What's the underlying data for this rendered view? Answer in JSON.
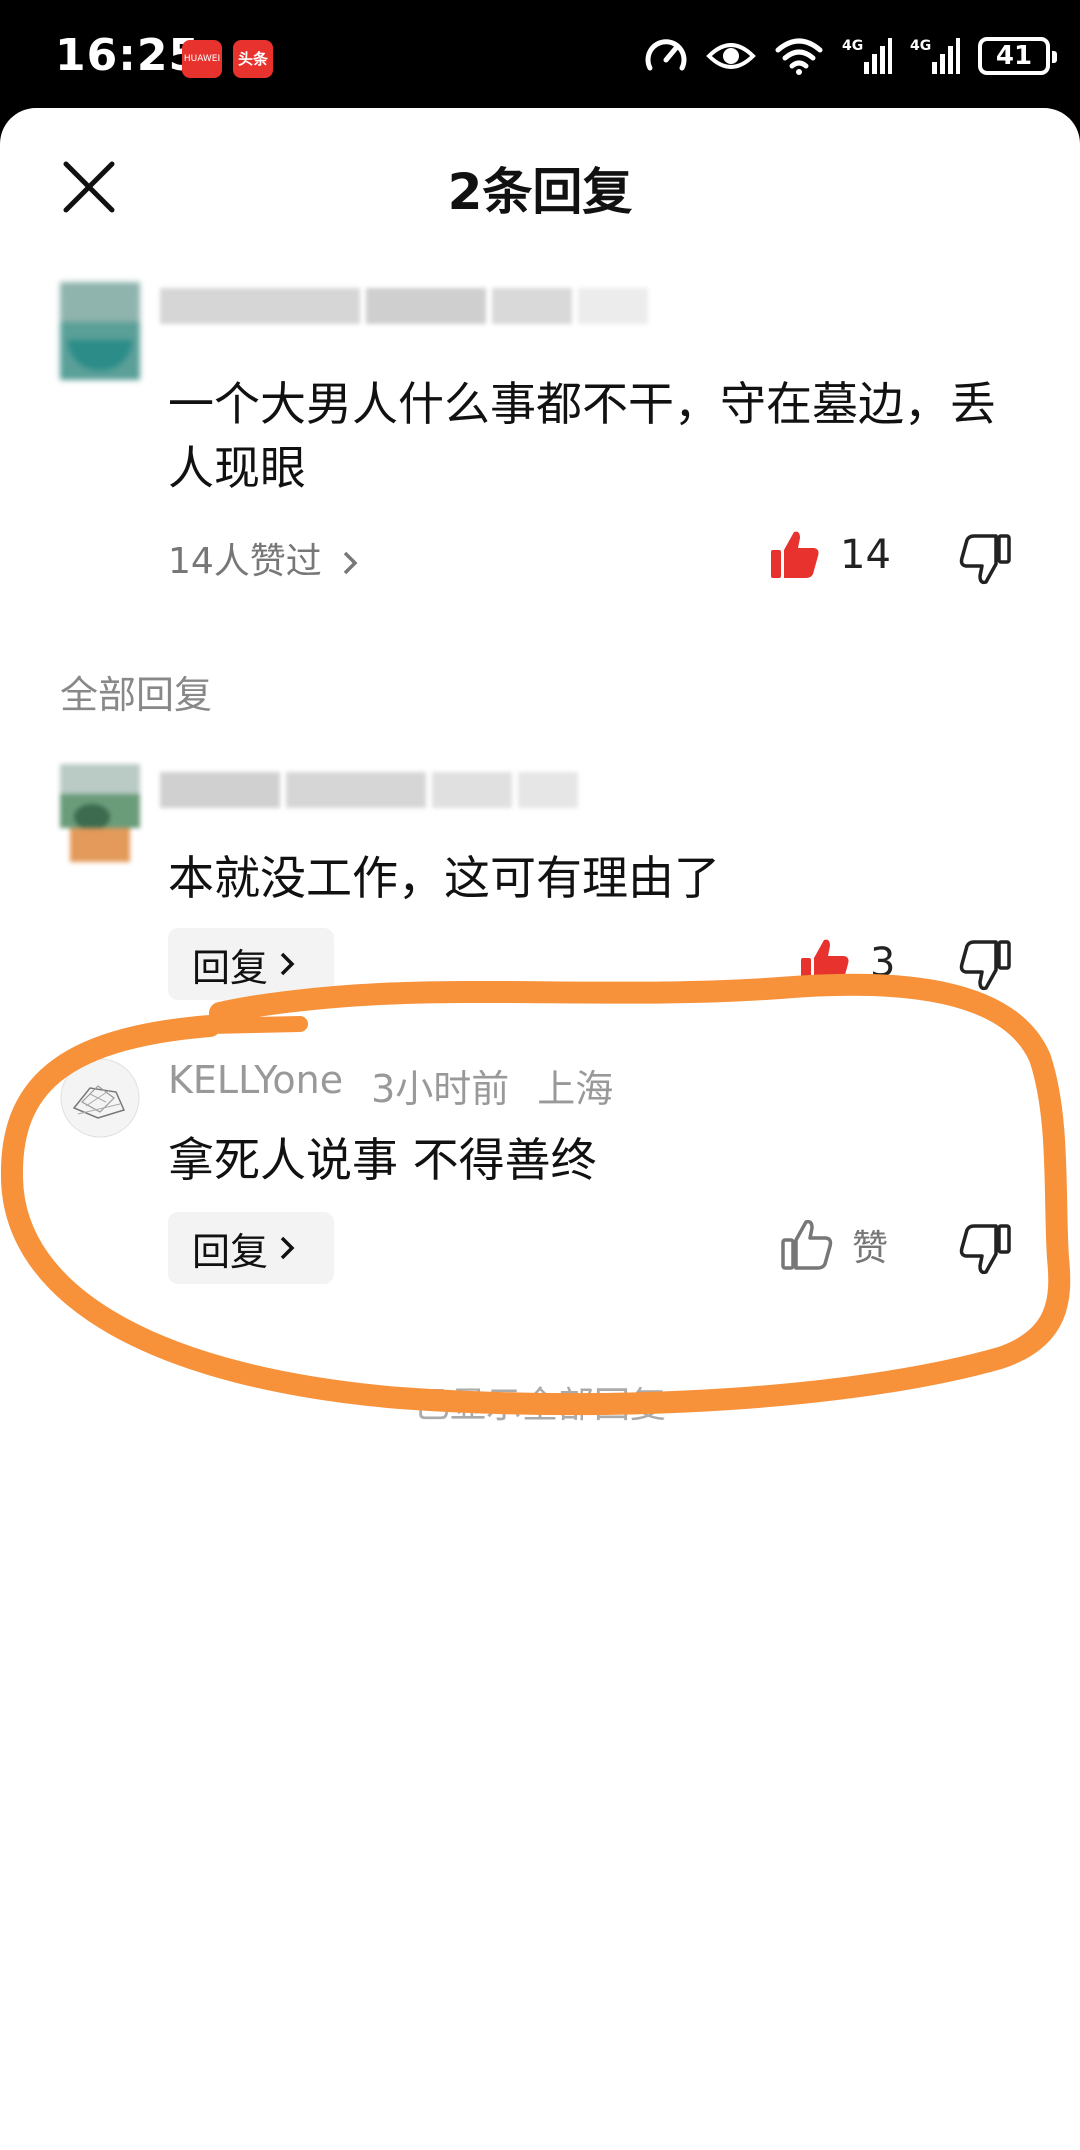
{
  "status_bar": {
    "time": "16:25",
    "apps": [
      "HUAWEI",
      "头条"
    ],
    "battery": "41"
  },
  "header": {
    "title": "2条回复"
  },
  "main_comment": {
    "text": "一个大男人什么事都不干，守在墓边，丢人现眼",
    "likes_link": "14人赞过",
    "like_count": "14"
  },
  "section_label": "全部回复",
  "replies": [
    {
      "text": "本就没工作，这可有理由了",
      "reply_label": "回复",
      "like_count": "3"
    },
    {
      "username": "KELLYone",
      "time": "3小时前",
      "location": "上海",
      "text": "拿死人说事 不得善终",
      "reply_label": "回复",
      "like_label": "赞"
    }
  ],
  "footer": "已显示全部回复",
  "colors": {
    "accent_red": "#e8322d",
    "annotation_orange": "#f7913a"
  }
}
